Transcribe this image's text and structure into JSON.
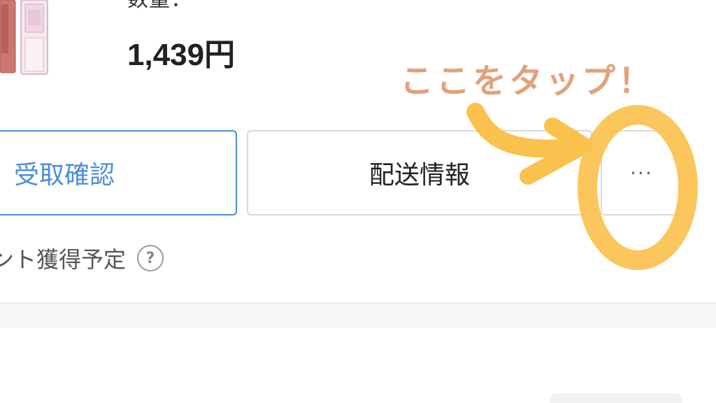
{
  "product": {
    "quantity_label": "数量：",
    "price": "1,439円"
  },
  "actions": {
    "receive_label": "受取確認",
    "shipping_label": "配送情報",
    "more_label": "···"
  },
  "points": {
    "label": "ント獲得予定",
    "help_label": "?"
  },
  "annotation": {
    "text": "ここをタップ！",
    "color": "#e2a27a",
    "highlight_color": "#fbc14d"
  },
  "colors": {
    "accent_blue": "#4a8ed8",
    "border_gray": "#d9d9d9"
  }
}
